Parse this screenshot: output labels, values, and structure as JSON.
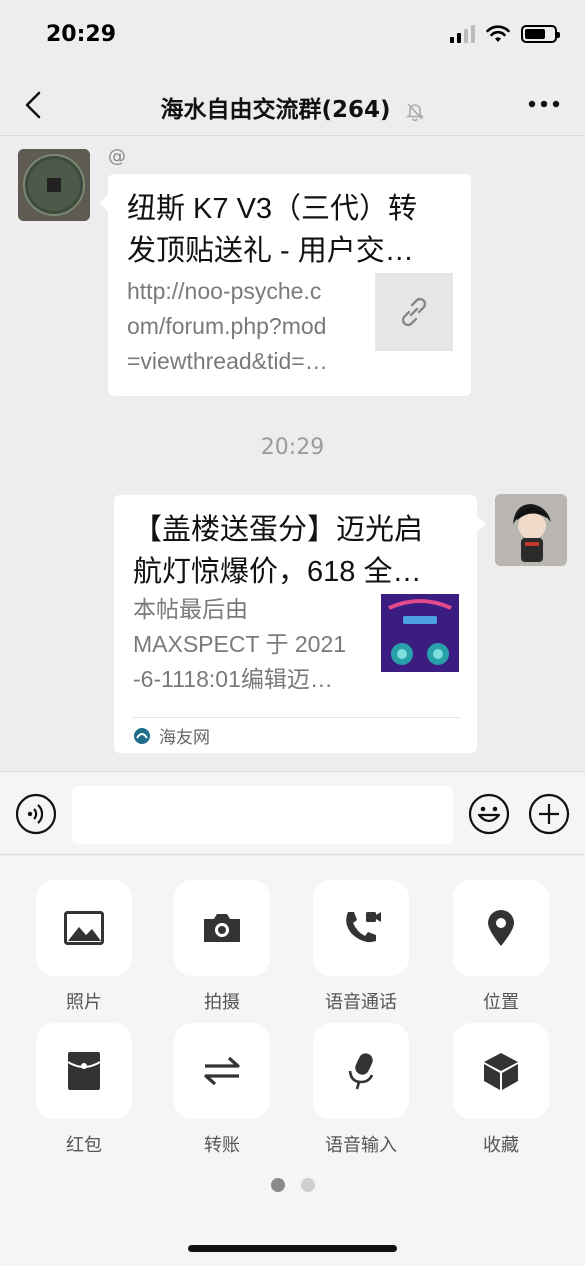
{
  "status_bar": {
    "time": "20:29"
  },
  "nav": {
    "title": "海水自由交流群(264)"
  },
  "messages": {
    "left": {
      "at_mark": "@",
      "title": "纽斯 K7 V3（三代）转发顶贴送礼 - 用户交…",
      "title_line1": "纽斯 K7 V3（三代）转",
      "title_line2": "发顶贴送礼 - 用户交…",
      "desc_line1": "http://noo-psyche.c",
      "desc_line2": "om/forum.php?mod",
      "desc_line3": "=viewthread&tid=…",
      "thumb_icon": "link-icon"
    },
    "timestamp": "20:29",
    "right": {
      "title_line1": "【盖楼送蛋分】迈光启",
      "title_line2": "航灯惊爆价，618 全…",
      "desc_line1": "本帖最后由",
      "desc_line2": "MAXSPECT 于 2021",
      "desc_line3": "-6-1118:01编辑迈…",
      "source": "海友网"
    }
  },
  "input_bar": {
    "placeholder": ""
  },
  "tools": [
    {
      "label": "照片",
      "icon": "photo-icon"
    },
    {
      "label": "拍摄",
      "icon": "camera-icon"
    },
    {
      "label": "语音通话",
      "icon": "video-call-icon"
    },
    {
      "label": "位置",
      "icon": "location-icon"
    },
    {
      "label": "红包",
      "icon": "red-packet-icon"
    },
    {
      "label": "转账",
      "icon": "transfer-icon"
    },
    {
      "label": "语音输入",
      "icon": "voice-input-icon"
    },
    {
      "label": "收藏",
      "icon": "favorites-icon"
    }
  ],
  "pagination": {
    "pages": 2,
    "current": 1
  },
  "colors": {
    "background": "#ededed",
    "bubble": "#ffffff",
    "panel": "#f5f5f5"
  }
}
